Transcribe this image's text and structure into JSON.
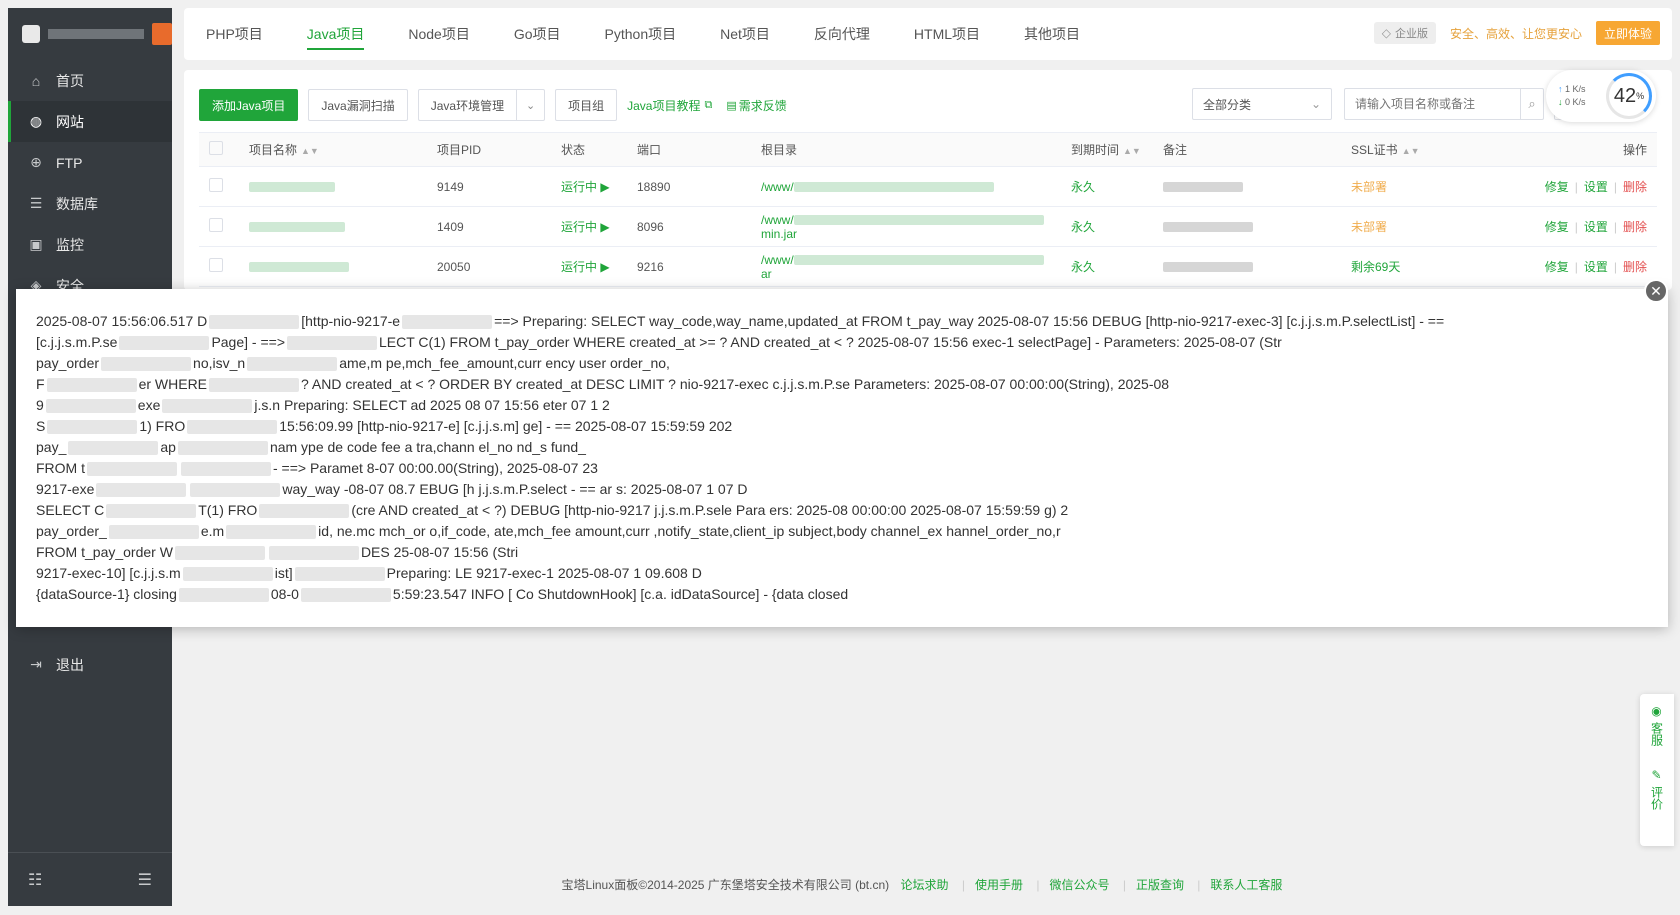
{
  "sidebar": {
    "items": [
      {
        "label": "首页",
        "icon": "home-icon"
      },
      {
        "label": "网站",
        "icon": "globe-icon"
      },
      {
        "label": "FTP",
        "icon": "ftp-icon"
      },
      {
        "label": "数据库",
        "icon": "database-icon"
      },
      {
        "label": "监控",
        "icon": "monitor-icon"
      },
      {
        "label": "安全",
        "icon": "shield-icon"
      }
    ],
    "logout": "退出"
  },
  "tabs": [
    "PHP项目",
    "Java项目",
    "Node项目",
    "Go项目",
    "Python项目",
    "Net项目",
    "反向代理",
    "HTML项目",
    "其他项目"
  ],
  "enterprise": {
    "badge": "企业版",
    "slogan": "安全、高效、让您更安心",
    "cta": "立即体验"
  },
  "toolbar": {
    "add": "添加Java项目",
    "scan": "Java漏洞扫描",
    "env": "Java环境管理",
    "group": "项目组",
    "tutorial": "Java项目教程",
    "feedback": "需求反馈",
    "category": "全部分类",
    "search_placeholder": "请输入项目名称或备注"
  },
  "speed": {
    "up": "1",
    "down": "0",
    "unit": "K/s",
    "percent": "42",
    "percent_unit": "%"
  },
  "table": {
    "headers": [
      "项目名称",
      "项目PID",
      "状态",
      "端口",
      "根目录",
      "到期时间",
      "备注",
      "SSL证书",
      "操作"
    ],
    "rows": [
      {
        "pid": "9149",
        "status": "运行中",
        "port": "18890",
        "path1": "/www/",
        "path2": "",
        "expiry": "永久",
        "ssl": "未部署"
      },
      {
        "pid": "1409",
        "status": "运行中",
        "port": "8096",
        "path1": "/www/",
        "path2": "min.jar",
        "expiry": "永久",
        "ssl": "未部署"
      },
      {
        "pid": "20050",
        "status": "运行中",
        "port": "9216",
        "path1": "/www/",
        "path2": "ar",
        "expiry": "永久",
        "ssl": "剩余69天"
      }
    ],
    "ops": {
      "repair": "修复",
      "settings": "设置",
      "delete": "删除"
    }
  },
  "log": {
    "lines": [
      "2025-08-07 15:56:06.517 D",
      "[c.j.j.s.m.P.se",
      "pay_order",
      "F",
      "9",
      "S",
      "pay_",
      "FROM t",
      "9217-exe",
      "SELECT C",
      "pay_order_",
      "FROM t_pay_order W",
      "9217-exec-10] [c.j.j.s.m",
      "{dataSource-1} closing"
    ],
    "tails": [
      "[http-nio-9217-e",
      "Page] - ==>",
      "no,isv_n",
      "er WHERE",
      "exe",
      "1) FRO",
      "ap",
      "",
      "",
      "T(1) FRO",
      "e.m",
      "",
      "ist]",
      "08-0"
    ],
    "frags": [
      "==> Preparing: SELECT way_code,way_name,updated_at FROM t_pay_way 2025-08-07 15:56 DEBUG [http-nio-9217-exec-3] [c.j.j.s.m.P.selectList] - ==",
      "LECT C(1) FROM t_pay_order WHERE created_at >= ? AND created_at < ? 2025-08-07 15:56 exec-1 selectPage] - Parameters: 2025-08-07 (Str",
      "ame,m pe,mch_fee_amount,curr ency user order_no,",
      "? AND created_at < ? ORDER BY created_at DESC LIMIT ? nio-9217-exec c.j.j.s.m.P.se Parameters: 2025-08-07 00:00:00(String), 2025-08",
      "j.s.n Preparing: SELECT ad 2025 08 07 15:56 eter 07 1 2",
      "15:56:09.99 [http-nio-9217-e] [c.j.j.s.m] ge] - == 2025-08-07 15:59:59 202",
      "nam ype de code fee a tra,chann el_no nd_s fund_",
      "- ==> Paramet 8-07 00:00.00(String), 2025-08-07 23",
      "way_way -08-07 08.7 EBUG [h j.j.s.m.P.select - == ar s: 2025-08-07 1 07 D",
      "(cre AND created_at < ?) DEBUG [http-nio-9217 j.j.s.m.P.sele Para ers: 2025-08 00:00:00 2025-08-07 15:59:59 g) 2",
      "id, ne.mc mch_or o,if_code, ate,mch_fee amount,curr ,notify_state,client_ip subject,body channel_ex hannel_order_no,r",
      "DES 25-08-07 15:56 (Stri",
      "Preparing: LE 9217-exec-1 2025-08-07 1 09.608 D",
      "5:59:23.547 INFO [ Co ShutdownHook] [c.a. idDataSource] - {data closed"
    ]
  },
  "float": {
    "service": "客服",
    "rate": "评价"
  },
  "footer": {
    "copyright": "宝塔Linux面板©2014-2025 广东堡塔安全技术有限公司 (bt.cn)",
    "links": [
      "论坛求助",
      "使用手册",
      "微信公众号",
      "正版查询",
      "联系人工客服"
    ]
  },
  "colors": {
    "brand": "#20a53a",
    "sidebar": "#363b40",
    "warn": "#f0ad4e",
    "danger": "#e35050"
  }
}
